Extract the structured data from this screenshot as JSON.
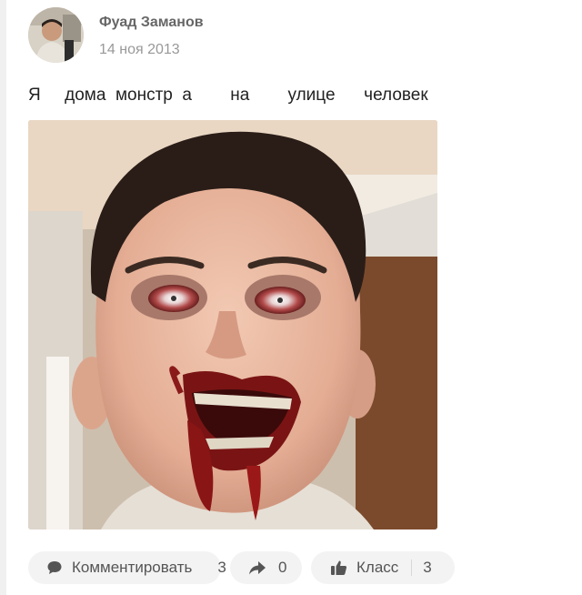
{
  "author": {
    "name": "Фуад Заманов",
    "date": "14 ноя 2013"
  },
  "post": {
    "text": "Я     дома  монстр  а        на        улице      человек"
  },
  "actions": {
    "comment": {
      "label": "Комментировать",
      "count": "3",
      "icon": "comment-icon"
    },
    "share": {
      "count": "0",
      "icon": "share-arrow-icon"
    },
    "like": {
      "label": "Класс",
      "count": "3",
      "icon": "thumbs-up-icon"
    }
  },
  "colors": {
    "pill_bg": "#f3f3f3",
    "author": "#666666",
    "date": "#999999",
    "text": "#222222"
  }
}
